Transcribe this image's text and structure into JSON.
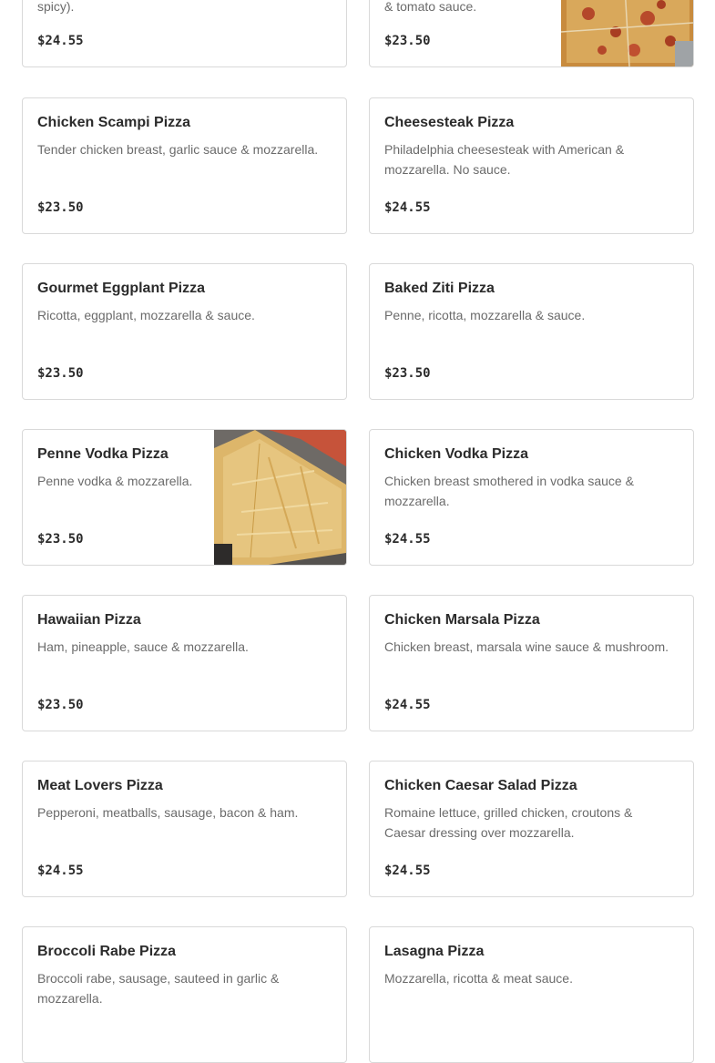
{
  "menu": {
    "items": [
      {
        "name": "",
        "description": "spicy).",
        "price": "$24.55"
      },
      {
        "name": "",
        "description": "& tomato sauce.",
        "price": "$23.50"
      },
      {
        "name": "Chicken Scampi Pizza",
        "description": "Tender chicken breast, garlic sauce & mozzarella.",
        "price": "$23.50"
      },
      {
        "name": "Cheesesteak Pizza",
        "description": "Philadelphia cheesesteak with American & mozzarella. No sauce.",
        "price": "$24.55"
      },
      {
        "name": "Gourmet Eggplant Pizza",
        "description": "Ricotta, eggplant, mozzarella & sauce.",
        "price": "$23.50"
      },
      {
        "name": "Baked Ziti Pizza",
        "description": "Penne, ricotta, mozzarella & sauce.",
        "price": "$23.50"
      },
      {
        "name": "Penne Vodka Pizza",
        "description": "Penne vodka & mozzarella.",
        "price": "$23.50"
      },
      {
        "name": "Chicken Vodka Pizza",
        "description": "Chicken breast smothered in vodka sauce & mozzarella.",
        "price": "$24.55"
      },
      {
        "name": "Hawaiian Pizza",
        "description": "Ham, pineapple, sauce & mozzarella.",
        "price": "$23.50"
      },
      {
        "name": "Chicken Marsala Pizza",
        "description": "Chicken breast, marsala wine sauce & mushroom.",
        "price": "$24.55"
      },
      {
        "name": "Meat Lovers Pizza",
        "description": "Pepperoni, meatballs, sausage, bacon & ham.",
        "price": "$24.55"
      },
      {
        "name": "Chicken Caesar Salad Pizza",
        "description": "Romaine lettuce, grilled chicken, croutons & Caesar dressing over mozzarella.",
        "price": "$24.55"
      },
      {
        "name": "Broccoli Rabe Pizza",
        "description": "Broccoli rabe, sausage, sauteed in garlic & mozzarella.",
        "price": ""
      },
      {
        "name": "Lasagna Pizza",
        "description": "Mozzarella, ricotta & meat sauce.",
        "price": ""
      }
    ]
  },
  "colors": {
    "card_border": "#d9d9d9",
    "text": "#2b2b2b",
    "muted_text": "#6b6b6b"
  }
}
